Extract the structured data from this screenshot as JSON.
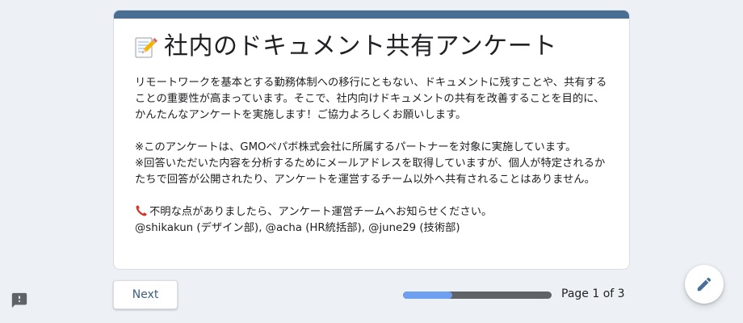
{
  "form": {
    "title": "社内のドキュメント共有アンケート",
    "title_icon": "memo-pencil-icon",
    "description": {
      "p1": "リモートワークを基本とする勤務体制への移行にともない、ドキュメントに残すことや、共有することの重要性が高まっています。そこで、社内向けドキュメントの共有を改善することを目的に、かんたんなアンケートを実施します！ご協力よろしくお願いします。",
      "p2_line1": "※このアンケートは、GMOペパボ株式会社に所属するパートナーを対象に実施しています。",
      "p2_line2": "※回答いただいた内容を分析するためにメールアドレスを取得していますが、個人が特定されるかたちで回答が公開されたり、アンケートを運営するチーム以外へ共有されることはありません。",
      "p3_line1": "不明な点がありましたら、アンケート運営チームへお知らせください。",
      "p3_line2": "@shikakun (デザイン部), @acha (HR統括部), @june29 (技術部)"
    }
  },
  "navigation": {
    "next_label": "Next",
    "page_indicator": "Page 1 of 3",
    "current_page": 1,
    "total_pages": 3,
    "progress_fraction": 0.33
  },
  "colors": {
    "accent": "#4a6f94",
    "background": "#edf0f4",
    "progress_fill": "#6f9ff0",
    "progress_track": "#5f6368",
    "button_text": "#3c5f82"
  },
  "icons": {
    "edit": "pencil-edit-icon",
    "feedback": "report-feedback-icon",
    "phone": "telephone-receiver-icon"
  }
}
